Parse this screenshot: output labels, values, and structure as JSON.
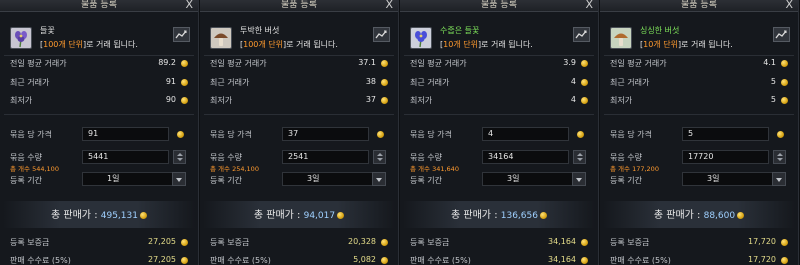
{
  "colors": {
    "accent_orange": "#ff9a2e",
    "total_value_blue": "#9fd0ff",
    "item_name_green": "#7ee35a",
    "footer_value_yellow": "#e4dc8a",
    "gold_coin": "#d9a514"
  },
  "icons": {
    "close": "close-icon",
    "chart": "price-chart-icon",
    "coin": "gold-coin-icon",
    "dropdown": "chevron-down-icon",
    "stepper": "stepper-arrows-icon"
  },
  "panels": [
    {
      "title": "물품 등록",
      "close": "X",
      "item_icon": "purple-flower-item-icon",
      "item_name": "들꽃",
      "item_name_green": false,
      "unit_prefix": "[",
      "unit_highlight": "100개 단위",
      "unit_suffix": "]로 거래 됩니다.",
      "avg_label": "전일 평균 거래가",
      "avg_value": "89.2",
      "recent_label": "최근 거래가",
      "recent_value": "91",
      "lowest_label": "최저가",
      "lowest_value": "90",
      "price_label": "묶음 당 가격",
      "price_value": "91",
      "qty_label": "묶음 수량",
      "qty_value": "5441",
      "total_qty_text": "총 개수 544,100",
      "period_label": "등록 기간",
      "period_value": "1일",
      "total_label": "총 판매가 : ",
      "total_value": "495,131",
      "deposit_label": "등록 보증금",
      "deposit_value": "27,205",
      "fee_label": "판매 수수료 (5%)",
      "fee_value": "27,205"
    },
    {
      "title": "물품 등록",
      "close": "X",
      "item_icon": "brown-mushroom-item-icon",
      "item_name": "투박한 버섯",
      "item_name_green": false,
      "unit_prefix": "[",
      "unit_highlight": "100개 단위",
      "unit_suffix": "]로 거래 됩니다.",
      "avg_label": "전일 평균 거래가",
      "avg_value": "37.1",
      "recent_label": "최근 거래가",
      "recent_value": "38",
      "lowest_label": "최저가",
      "lowest_value": "37",
      "price_label": "묶음 당 가격",
      "price_value": "37",
      "qty_label": "묶음 수량",
      "qty_value": "2541",
      "total_qty_text": "총 개수 254,100",
      "period_label": "등록 기간",
      "period_value": "3일",
      "total_label": "총 판매가 : ",
      "total_value": "94,017",
      "deposit_label": "등록 보증금",
      "deposit_value": "20,328",
      "fee_label": "판매 수수료 (5%)",
      "fee_value": "5,082"
    },
    {
      "title": "물품 등록",
      "close": "X",
      "item_icon": "blue-flower-item-icon",
      "item_name": "수줍은 들꽃",
      "item_name_green": true,
      "unit_prefix": "[",
      "unit_highlight": "10개 단위",
      "unit_suffix": "]로 거래 됩니다.",
      "avg_label": "전일 평균 거래가",
      "avg_value": "3.9",
      "recent_label": "최근 거래가",
      "recent_value": "4",
      "lowest_label": "최저가",
      "lowest_value": "4",
      "price_label": "묶음 당 가격",
      "price_value": "4",
      "qty_label": "묶음 수량",
      "qty_value": "34164",
      "total_qty_text": "총 개수 341,640",
      "period_label": "등록 기간",
      "period_value": "3일",
      "total_label": "총 판매가 : ",
      "total_value": "136,656",
      "deposit_label": "등록 보증금",
      "deposit_value": "34,164",
      "fee_label": "판매 수수료 (5%)",
      "fee_value": "34,164"
    },
    {
      "title": "물품 등록",
      "close": "X",
      "item_icon": "fresh-mushroom-item-icon",
      "item_name": "싱싱한 버섯",
      "item_name_green": true,
      "unit_prefix": "[",
      "unit_highlight": "10개 단위",
      "unit_suffix": "]로 거래 됩니다.",
      "avg_label": "전일 평균 거래가",
      "avg_value": "4.1",
      "recent_label": "최근 거래가",
      "recent_value": "5",
      "lowest_label": "최저가",
      "lowest_value": "5",
      "price_label": "묶음 당 가격",
      "price_value": "5",
      "qty_label": "묶음 수량",
      "qty_value": "17720",
      "total_qty_text": "총 개수 177,200",
      "period_label": "등록 기간",
      "period_value": "3일",
      "total_label": "총 판매가 : ",
      "total_value": "88,600",
      "deposit_label": "등록 보증금",
      "deposit_value": "17,720",
      "fee_label": "판매 수수료 (5%)",
      "fee_value": "17,720"
    }
  ]
}
